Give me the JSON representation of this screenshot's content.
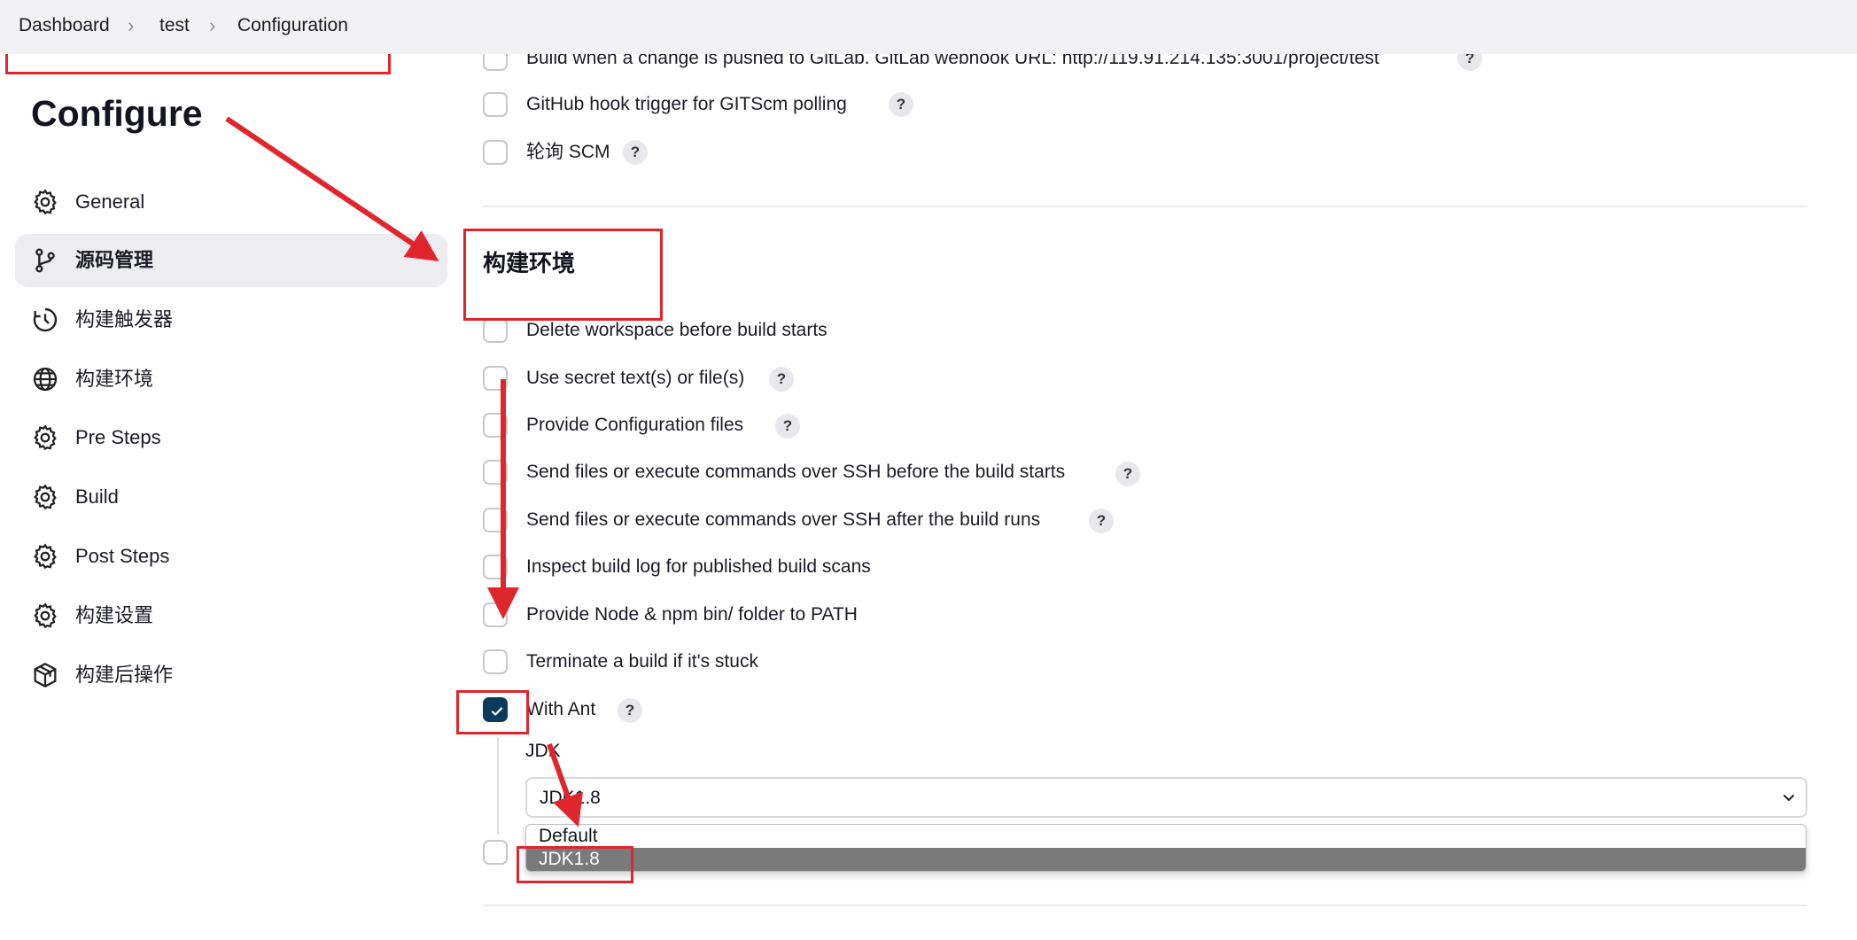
{
  "breadcrumb": {
    "items": [
      "Dashboard",
      "test",
      "Configuration"
    ]
  },
  "page_title": "Configure",
  "sidebar": {
    "items": [
      {
        "label": "General",
        "icon": "gear-icon"
      },
      {
        "label": "源码管理",
        "icon": "branch-icon",
        "active": true
      },
      {
        "label": "构建触发器",
        "icon": "clock-icon"
      },
      {
        "label": "构建环境",
        "icon": "globe-icon"
      },
      {
        "label": "Pre Steps",
        "icon": "gear-icon"
      },
      {
        "label": "Build",
        "icon": "gear-icon"
      },
      {
        "label": "Post Steps",
        "icon": "gear-icon"
      },
      {
        "label": "构建设置",
        "icon": "gear-icon"
      },
      {
        "label": "构建后操作",
        "icon": "package-icon"
      }
    ]
  },
  "triggers": {
    "options": [
      {
        "label": "Build when a change is pushed to GitLab. GitLab webhook URL: http://119.91.214.135:3001/project/test",
        "checked": false,
        "help": "?"
      },
      {
        "label": "GitHub hook trigger for GITScm polling",
        "checked": false,
        "help": "?"
      },
      {
        "label": "轮询 SCM",
        "checked": false,
        "help": "?"
      }
    ]
  },
  "build_env": {
    "title": "构建环境",
    "options": [
      {
        "label": "Delete workspace before build starts",
        "checked": false
      },
      {
        "label": "Use secret text(s) or file(s)",
        "checked": false,
        "help": "?"
      },
      {
        "label": "Provide Configuration files",
        "checked": false,
        "help": "?"
      },
      {
        "label": "Send files or execute commands over SSH before the build starts",
        "checked": false,
        "help": "?"
      },
      {
        "label": "Send files or execute commands over SSH after the build runs",
        "checked": false,
        "help": "?"
      },
      {
        "label": "Inspect build log for published build scans",
        "checked": false
      },
      {
        "label": "Provide Node & npm bin/ folder to PATH",
        "checked": false
      },
      {
        "label": "Terminate a build if it's stuck",
        "checked": false
      },
      {
        "label": "With Ant",
        "checked": true,
        "help": "?"
      }
    ],
    "ant": {
      "jdk_label": "JDK",
      "jdk_selected": "JDK1.8",
      "jdk_options": [
        "Default",
        "JDK1.8"
      ]
    }
  },
  "colors": {
    "annotation_red": "#e0262d",
    "checkbox_checked": "#0a3a5c",
    "sidebar_active_bg": "#ededf1"
  }
}
